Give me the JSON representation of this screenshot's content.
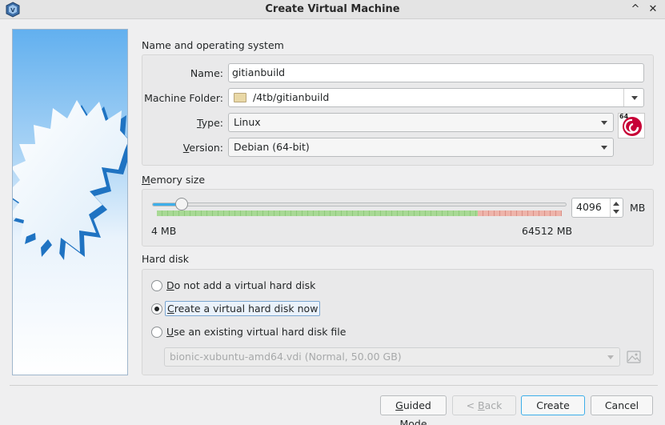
{
  "window": {
    "title": "Create Virtual Machine",
    "minimize_glyph": "^",
    "close_glyph": "✕"
  },
  "name_os": {
    "group_title": "Name and operating system",
    "name_label": "Name:",
    "name_value": "gitianbuild",
    "folder_label": "Machine Folder:",
    "folder_value": "/4tb/gitianbuild",
    "type_label_prefix": "T",
    "type_label_rest": "ype:",
    "type_value": "Linux",
    "version_label_prefix": "V",
    "version_label_rest": "ersion:",
    "version_value": "Debian (64-bit)",
    "os_badge_text": "64"
  },
  "memory": {
    "group_title_prefix": "M",
    "group_title_rest": "emory size",
    "value": "4096",
    "unit": "MB",
    "min_label": "4 MB",
    "max_label": "64512 MB",
    "level_fraction": 0.063
  },
  "hard_disk": {
    "group_title": "Hard disk",
    "options": [
      {
        "prefix": "D",
        "rest": "o not add a virtual hard disk",
        "checked": false
      },
      {
        "prefix": "C",
        "rest": "reate a virtual hard disk now",
        "checked": true
      },
      {
        "prefix": "U",
        "rest": "se an existing virtual hard disk file",
        "checked": false
      }
    ],
    "existing_file_value": "bionic-xubuntu-amd64.vdi (Normal, 50.00 GB)"
  },
  "buttons": {
    "guided_prefix": "G",
    "guided_rest": "uided Mode",
    "back_prefix": "< ",
    "back_u": "B",
    "back_rest": "ack",
    "create": "Create",
    "cancel": "Cancel"
  },
  "colors": {
    "accent": "#3daee9",
    "star_blue": "#2f8fd6",
    "banner_top": "#6fb7f0",
    "debian_red": "#c70036"
  }
}
